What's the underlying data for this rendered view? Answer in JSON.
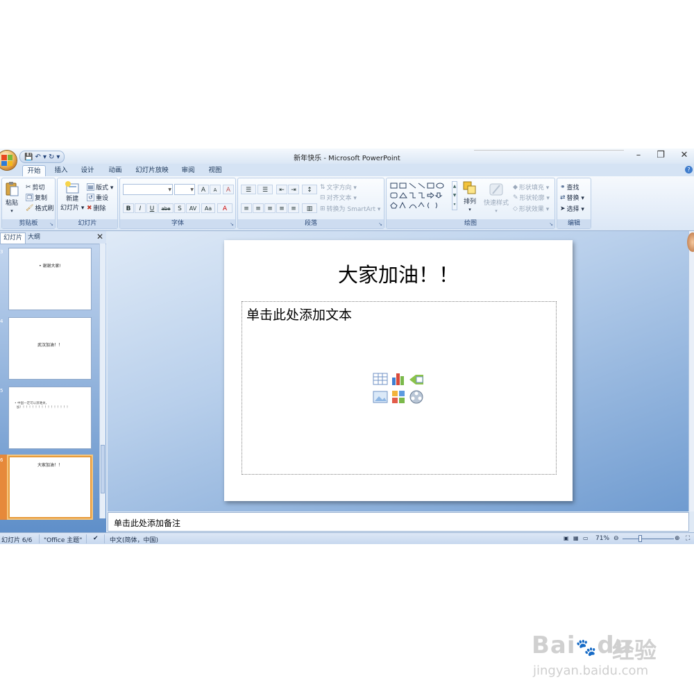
{
  "window": {
    "title": "新年快乐 - Microsoft PowerPoint",
    "controls": {
      "minimize": "–",
      "restore": "❐",
      "close": "✕"
    }
  },
  "qat": {
    "save": "💾",
    "undo": "↶ ▾",
    "redo": "↻",
    "more": "▾"
  },
  "tabs": [
    "开始",
    "插入",
    "设计",
    "动画",
    "幻灯片放映",
    "审阅",
    "视图"
  ],
  "ribbon": {
    "clipboard": {
      "paste": "粘贴",
      "cut": "剪切",
      "copy": "复制",
      "format_painter": "格式刷",
      "label": "剪贴板"
    },
    "slides": {
      "new_slide_1": "新建",
      "new_slide_2": "幻灯片 ▾",
      "layout": "版式 ▾",
      "reset": "重设",
      "delete": "删除",
      "label": "幻灯片"
    },
    "font": {
      "grow": "A",
      "shrink": "A",
      "clear": "A",
      "bold": "B",
      "italic": "I",
      "underline": "U",
      "strike": "abe",
      "shadow": "S",
      "spacing": "AV",
      "case": "Aa",
      "color": "A",
      "label": "字体"
    },
    "paragraph": {
      "text_direction": "文字方向 ▾",
      "align_text": "对齐文本 ▾",
      "smartart": "转换为 SmartArt ▾",
      "label": "段落"
    },
    "drawing": {
      "arrange": "排列",
      "quick_styles": "快速样式",
      "shape_fill": "形状填充 ▾",
      "shape_outline": "形状轮廓 ▾",
      "shape_effects": "形状效果 ▾",
      "label": "绘图"
    },
    "editing": {
      "find": "查找",
      "replace": "替换 ▾",
      "select": "选择 ▾",
      "label": "编辑"
    }
  },
  "left_pane": {
    "tabs": [
      "幻灯片",
      "大纲"
    ],
    "close": "✕",
    "thumbnails": [
      {
        "num": "3",
        "text": "• 谢谢大家!"
      },
      {
        "num": "4",
        "text": "武汉加油！！"
      },
      {
        "num": "5",
        "text": "• 中国一定可以渡难关，\n  加！！！！！！！！！！！！！！！！"
      },
      {
        "num": "6",
        "text": "大家加油！！"
      }
    ]
  },
  "slide": {
    "title": "大家加油！！",
    "content_placeholder": "单击此处添加文本"
  },
  "notes": {
    "placeholder": "单击此处添加备注"
  },
  "status": {
    "slide_count": "幻灯片 6/6",
    "theme": "\"Office 主题\"",
    "language": "中文(简体，中国)",
    "zoom": "71%",
    "zoom_out": "⊖",
    "zoom_in": "⊕"
  },
  "watermark": {
    "brand": "Bai",
    "brand2": "du",
    "cn": "经验",
    "url": "jingyan.baidu.com"
  },
  "colors": {
    "accent": "#3f6ea8",
    "ribbon_bg": "#dbe7f6",
    "selected_thumb": "#e69a3a"
  }
}
